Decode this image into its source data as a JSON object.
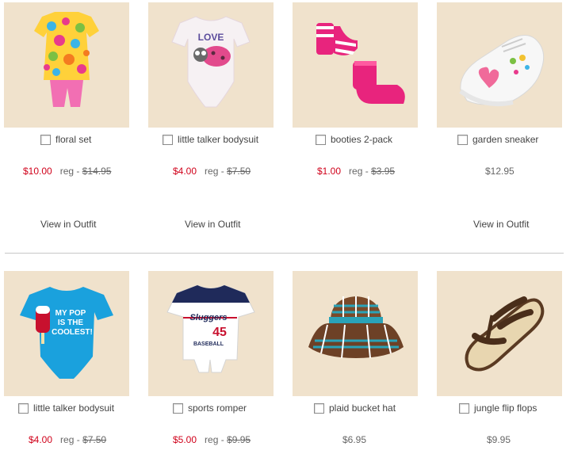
{
  "products": [
    {
      "name": "floral set",
      "price_sale": "$10.00",
      "price_reg_label": "reg - ",
      "price_reg": "$14.95",
      "outfit_link": "View in Outfit",
      "image": "floral-set-image"
    },
    {
      "name": "little talker bodysuit",
      "price_sale": "$4.00",
      "price_reg_label": "reg - ",
      "price_reg": "$7.50",
      "outfit_link": "View in Outfit",
      "image": "ladybug-bodysuit-image"
    },
    {
      "name": "booties 2-pack",
      "price_sale": "$1.00",
      "price_reg_label": "reg - ",
      "price_reg": "$3.95",
      "image": "booties-image"
    },
    {
      "name": "garden sneaker",
      "price": "$12.95",
      "outfit_link": "View in Outfit",
      "image": "sneaker-image"
    },
    {
      "name": "little talker bodysuit",
      "price_sale": "$4.00",
      "price_reg_label": "reg - ",
      "price_reg": "$7.50",
      "image": "pop-bodysuit-image"
    },
    {
      "name": "sports romper",
      "price_sale": "$5.00",
      "price_reg_label": "reg - ",
      "price_reg": "$9.95",
      "image": "romper-image"
    },
    {
      "name": "plaid bucket hat",
      "price": "$6.95",
      "image": "bucket-hat-image"
    },
    {
      "name": "jungle flip flops",
      "price": "$9.95",
      "image": "flip-flops-image"
    }
  ],
  "image_text": {
    "love": "LOVE",
    "pop": [
      "MY POP",
      "IS THE",
      "COOLEST!"
    ],
    "romper": [
      "Sluggers",
      "45",
      "BASEBALL"
    ]
  },
  "colors": {
    "sale": "#d0021b",
    "image_bg": "#f0e2cc",
    "divider": "#c8c8c8"
  }
}
